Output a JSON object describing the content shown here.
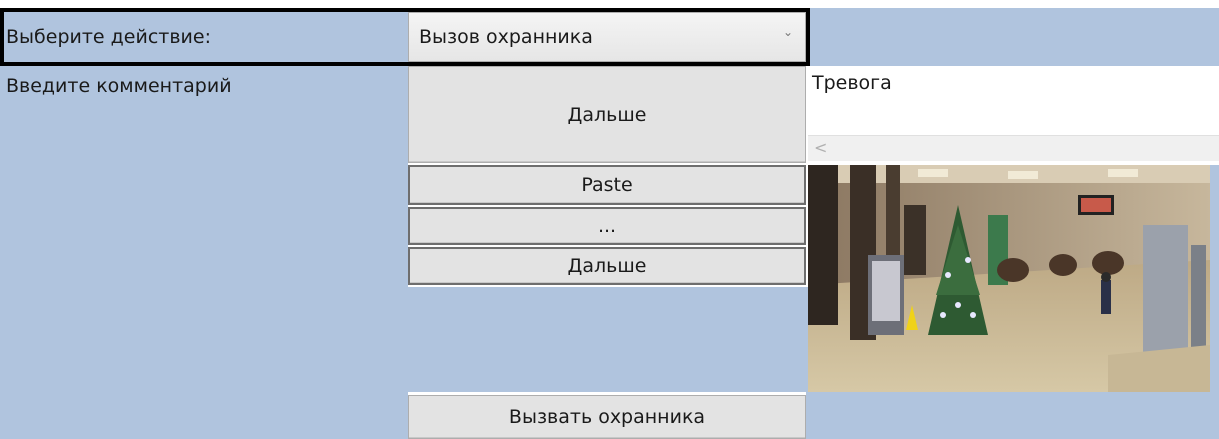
{
  "action_row": {
    "label": "Выберите действие:",
    "selected_action": "Вызов охранника"
  },
  "comment_row": {
    "label": "Введите комментарий",
    "next_label": "Дальше",
    "comment_text": "Тревога"
  },
  "keypad": {
    "paste_label": "Paste",
    "ellipsis_label": "...",
    "next_label": "Дальше"
  },
  "footer": {
    "call_guard_label": "Вызвать охранника"
  },
  "colors": {
    "panel": "#b0c4de",
    "button": "#e3e3e3",
    "frame": "#000000"
  },
  "camera_alt": "Кадр с камеры: холл с ёлкой"
}
